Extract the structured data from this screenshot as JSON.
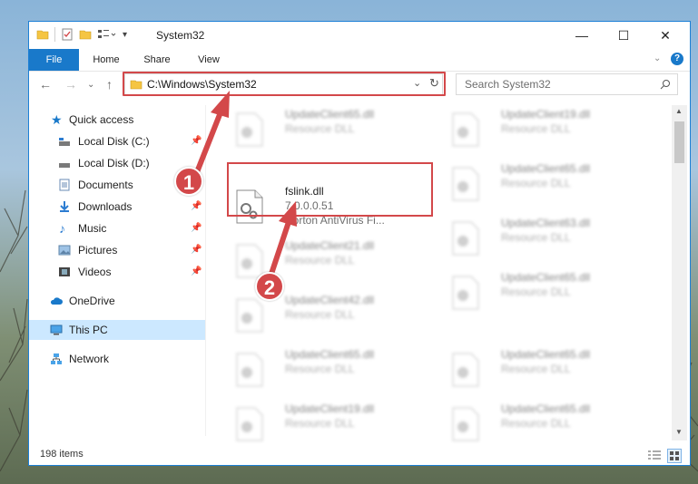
{
  "window": {
    "title": "System32",
    "controls": {
      "minimize": "—",
      "maximize": "☐",
      "close": "✕"
    }
  },
  "ribbon": {
    "tabs": [
      "File",
      "Home",
      "Share",
      "View"
    ]
  },
  "address": {
    "path": "C:\\Windows\\System32",
    "search_placeholder": "Search System32"
  },
  "sidebar": {
    "items": [
      {
        "label": "Quick access",
        "icon": "star-icon"
      },
      {
        "label": "Local Disk (C:)",
        "icon": "drive-icon"
      },
      {
        "label": "Local Disk (D:)",
        "icon": "drive-icon"
      },
      {
        "label": "Documents",
        "icon": "documents-icon"
      },
      {
        "label": "Downloads",
        "icon": "download-icon"
      },
      {
        "label": "Music",
        "icon": "music-icon"
      },
      {
        "label": "Pictures",
        "icon": "pictures-icon"
      },
      {
        "label": "Videos",
        "icon": "videos-icon"
      },
      {
        "label": "OneDrive",
        "icon": "cloud-icon"
      },
      {
        "label": "This PC",
        "icon": "computer-icon"
      },
      {
        "label": "Network",
        "icon": "network-icon"
      }
    ]
  },
  "files": {
    "focused": {
      "name": "fslink.dll",
      "version": "7.0.0.0.51",
      "description": "Norton AntiVirus Fi..."
    },
    "blurred": [
      {
        "name": "UpdateClient65.dll",
        "type": "Resource DLL"
      },
      {
        "name": "UpdateClient19.dll",
        "type": "Resource DLL"
      },
      {
        "name": "UpdateClient65.dll",
        "type": "Resource DLL"
      },
      {
        "name": "UpdateClient21.dll",
        "type": "Resource DLL"
      },
      {
        "name": "UpdateClient63.dll",
        "type": "Resource DLL"
      },
      {
        "name": "UpdateClient42.dll",
        "type": "Resource DLL"
      },
      {
        "name": "UpdateClient65.dll",
        "type": "Resource DLL"
      },
      {
        "name": "UpdateClient65.dll",
        "type": "Resource DLL"
      },
      {
        "name": "UpdateClient65.dll",
        "type": "Resource DLL"
      },
      {
        "name": "UpdateClient19.dll",
        "type": "Resource DLL"
      },
      {
        "name": "UpdateClient65.dll",
        "type": "Resource DLL"
      }
    ]
  },
  "status": {
    "item_count": "198 items"
  },
  "annotations": {
    "step1": "1",
    "step2": "2"
  },
  "colors": {
    "accent": "#1979ca",
    "highlight": "#d3484a",
    "selection": "#cce8ff"
  }
}
